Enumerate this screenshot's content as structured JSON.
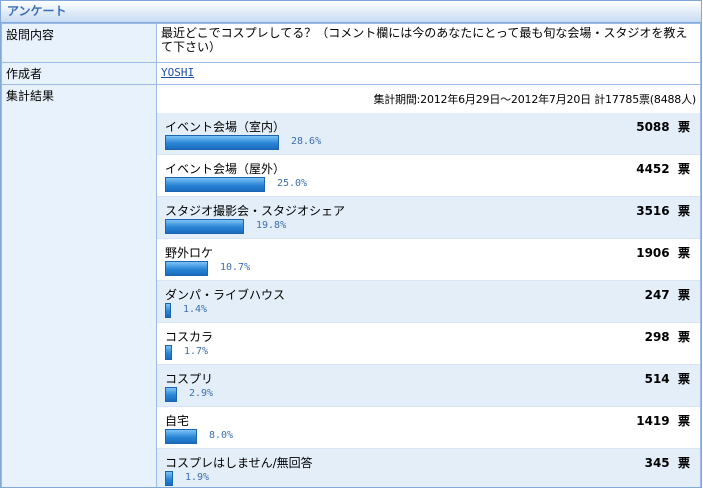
{
  "header": {
    "title": "アンケート"
  },
  "question": {
    "label": "設問内容",
    "text": "最近どこでコスプレしてる？（コメント欄には今のあなたにとって最も旬な会場・スタジオを教えて下さい）"
  },
  "author": {
    "label": "作成者",
    "name": "YOSHI"
  },
  "results": {
    "label": "集計結果",
    "period": "集計期間:2012年6月29日〜2012年7月20日 計17785票(8488人)",
    "vote_unit": "票",
    "items": [
      {
        "name": "イベント会場（室内）",
        "votes": "5088",
        "percent": "28.6%",
        "share": 28.6
      },
      {
        "name": "イベント会場（屋外）",
        "votes": "4452",
        "percent": "25.0%",
        "share": 25.0
      },
      {
        "name": "スタジオ撮影会・スタジオシェア",
        "votes": "3516",
        "percent": "19.8%",
        "share": 19.8
      },
      {
        "name": "野外ロケ",
        "votes": "1906",
        "percent": "10.7%",
        "share": 10.7
      },
      {
        "name": "ダンパ・ライブハウス",
        "votes": "247",
        "percent": "1.4%",
        "share": 1.4
      },
      {
        "name": "コスカラ",
        "votes": "298",
        "percent": "1.7%",
        "share": 1.7
      },
      {
        "name": "コスプリ",
        "votes": "514",
        "percent": "2.9%",
        "share": 2.9
      },
      {
        "name": "自宅",
        "votes": "1419",
        "percent": "8.0%",
        "share": 8.0
      },
      {
        "name": "コスプレはしません/無回答",
        "votes": "345",
        "percent": "1.9%",
        "share": 1.9
      }
    ]
  }
}
